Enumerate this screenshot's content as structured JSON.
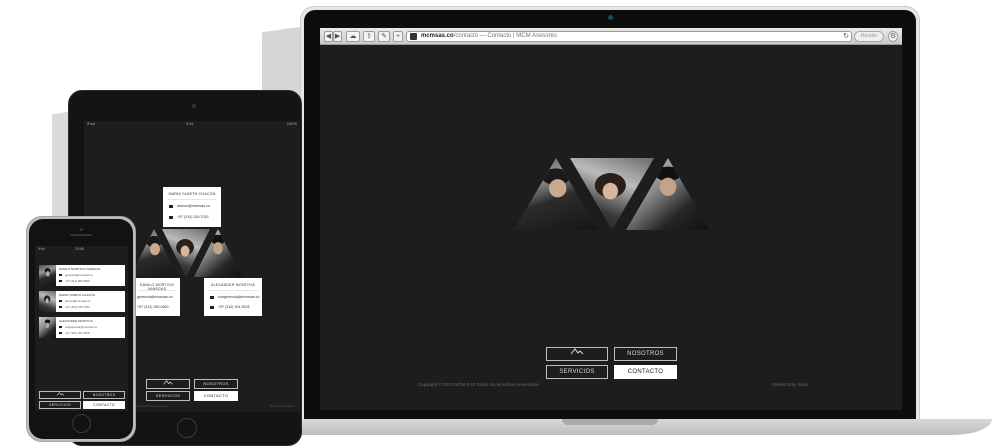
{
  "browser": {
    "domain": "mcmsas.co",
    "path_title": "/contacto — Contacto | MCM Asesores",
    "reader_label": "Reader"
  },
  "nav": {
    "nosotros": "NOSOTROS",
    "servicios": "SERVICIOS",
    "contacto": "CONTACTO"
  },
  "footer": {
    "copyright": "Copyright © 2013 MCM SAS Todos los derechos reservados.",
    "credit": "Diseño Emy Sans"
  },
  "tablet": {
    "status_left": "iPad",
    "status_time": "9:41",
    "status_right": "100%",
    "cards": [
      {
        "name": "MARIA YANETH CHACÓN",
        "email": "admon@mcmsas.co",
        "phone": "+57 (310) 316 7033"
      },
      {
        "name": "DANILO MORTIGO VANEGAS",
        "email": "gerencia@mcmsas.co",
        "phone": "+57 (312) 383 0660"
      },
      {
        "name": "ALEXANDER MONTOYA",
        "email": "subgerencia@mcmsas.co",
        "phone": "+57 (310) 301 5578"
      }
    ],
    "footer_copyright": "Copyright © 2013 MCM SAS Todos los derechos reservados.",
    "footer_credit": "Diseño Emy Sans"
  },
  "phone": {
    "carrier": "iPod",
    "time": "23:48",
    "cards": [
      {
        "name": "DANILO MORTIGO VANEGAS",
        "email": "gerencia@mcmsas.co",
        "phone": "+57 (312) 383 0660"
      },
      {
        "name": "MARIA YANETH CHACÓN",
        "email": "admon@mcmsas.co",
        "phone": "+57 (310) 316 7033"
      },
      {
        "name": "ALEXANDER MONTOYA",
        "email": "subgerencia@mcmsas.co",
        "phone": "+57 (310) 301 5578"
      }
    ]
  },
  "icons": [
    "back-icon",
    "forward-icon",
    "cloud-icon",
    "share-icon",
    "bookmarks-icon",
    "add-tab-icon",
    "refresh-icon",
    "settings-icon",
    "mcm-logo-icon",
    "email-icon",
    "phone-icon"
  ]
}
